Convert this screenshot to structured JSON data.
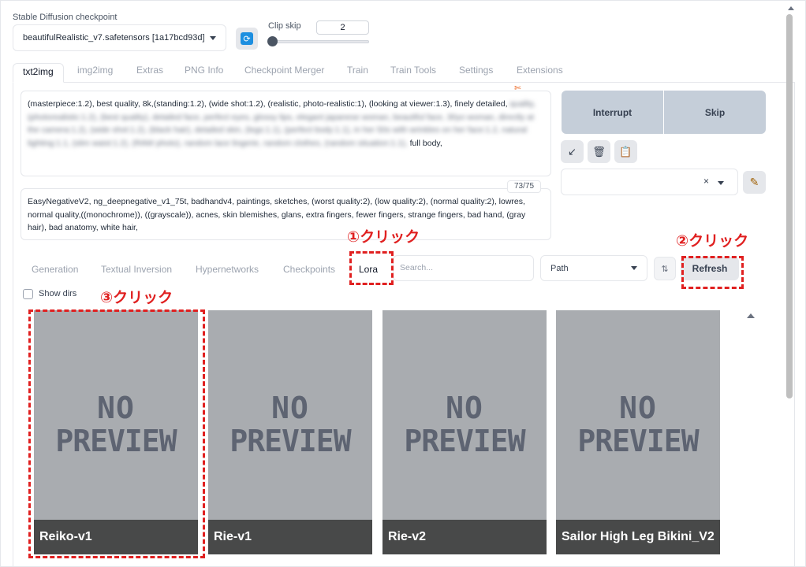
{
  "checkpoint": {
    "label": "Stable Diffusion checkpoint",
    "value": "beautifulRealistic_v7.safetensors [1a17bcd93d]"
  },
  "clip_skip": {
    "label": "Clip skip",
    "value": "2"
  },
  "tabs": [
    {
      "label": "txt2img",
      "active": true
    },
    {
      "label": "img2img"
    },
    {
      "label": "Extras"
    },
    {
      "label": "PNG Info"
    },
    {
      "label": "Checkpoint Merger"
    },
    {
      "label": "Train"
    },
    {
      "label": "Train Tools"
    },
    {
      "label": "Settings"
    },
    {
      "label": "Extensions"
    }
  ],
  "prompt": {
    "visible_start": "(masterpiece:1.2), best quality, 8k,(standing:1.2), (wide shot:1.2), (realistic, photo-realistic:1), (looking at viewer:1.3), finely detailed,",
    "visible_end": "full body,"
  },
  "negative_prompt": {
    "text": "EasyNegativeV2, ng_deepnegative_v1_75t, badhandv4, paintings, sketches, (worst quality:2), (low quality:2), (normal quality:2), lowres, normal quality,((monochrome)), ((grayscale)), acnes, skin blemishes, glans, extra fingers, fewer fingers, strange fingers, bad hand, (gray hair), bad anatomy, white hair,",
    "token_count": "73/75"
  },
  "actions": {
    "interrupt": "Interrupt",
    "skip": "Skip"
  },
  "extra_tabs": [
    {
      "label": "Generation"
    },
    {
      "label": "Textual Inversion"
    },
    {
      "label": "Hypernetworks"
    },
    {
      "label": "Checkpoints"
    },
    {
      "label": "Lora",
      "active": true
    }
  ],
  "search": {
    "placeholder": "Search..."
  },
  "sort": {
    "value": "Path"
  },
  "refresh_label": "Refresh",
  "show_dirs_label": "Show dirs",
  "cards": [
    {
      "name": "Reiko-v1"
    },
    {
      "name": "Rie-v1"
    },
    {
      "name": "Rie-v2"
    },
    {
      "name": "Sailor High Leg Bikini_V2"
    }
  ],
  "no_preview": {
    "line1": "NO",
    "line2": "PREVIEW"
  },
  "annotations": {
    "step1": "①クリック",
    "step2": "②クリック",
    "step3": "③クリック"
  },
  "colors": {
    "annotation_red": "#e02020",
    "action_button_bg": "#c5ced9",
    "card_bg": "#a9acb0"
  }
}
